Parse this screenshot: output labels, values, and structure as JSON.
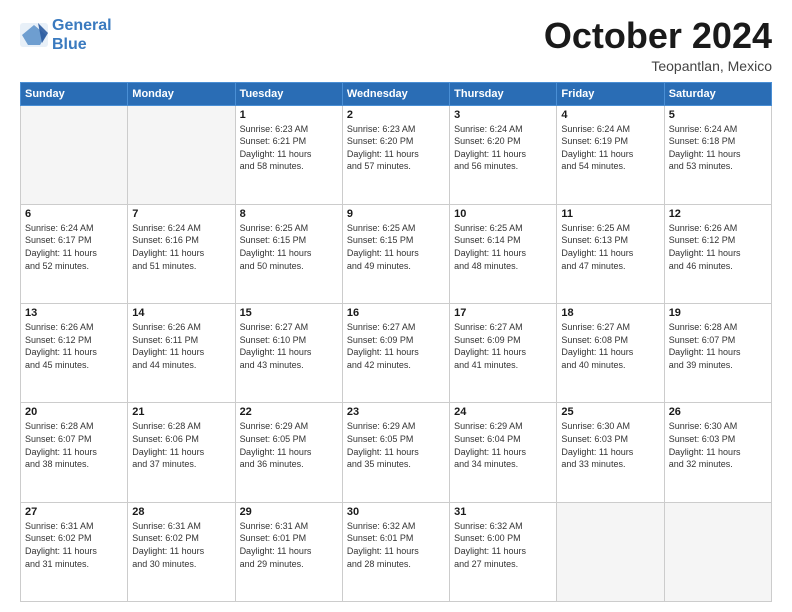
{
  "header": {
    "logo_line1": "General",
    "logo_line2": "Blue",
    "month": "October 2024",
    "location": "Teopantlan, Mexico"
  },
  "weekdays": [
    "Sunday",
    "Monday",
    "Tuesday",
    "Wednesday",
    "Thursday",
    "Friday",
    "Saturday"
  ],
  "weeks": [
    [
      {
        "day": "",
        "info": ""
      },
      {
        "day": "",
        "info": ""
      },
      {
        "day": "1",
        "info": "Sunrise: 6:23 AM\nSunset: 6:21 PM\nDaylight: 11 hours\nand 58 minutes."
      },
      {
        "day": "2",
        "info": "Sunrise: 6:23 AM\nSunset: 6:20 PM\nDaylight: 11 hours\nand 57 minutes."
      },
      {
        "day": "3",
        "info": "Sunrise: 6:24 AM\nSunset: 6:20 PM\nDaylight: 11 hours\nand 56 minutes."
      },
      {
        "day": "4",
        "info": "Sunrise: 6:24 AM\nSunset: 6:19 PM\nDaylight: 11 hours\nand 54 minutes."
      },
      {
        "day": "5",
        "info": "Sunrise: 6:24 AM\nSunset: 6:18 PM\nDaylight: 11 hours\nand 53 minutes."
      }
    ],
    [
      {
        "day": "6",
        "info": "Sunrise: 6:24 AM\nSunset: 6:17 PM\nDaylight: 11 hours\nand 52 minutes."
      },
      {
        "day": "7",
        "info": "Sunrise: 6:24 AM\nSunset: 6:16 PM\nDaylight: 11 hours\nand 51 minutes."
      },
      {
        "day": "8",
        "info": "Sunrise: 6:25 AM\nSunset: 6:15 PM\nDaylight: 11 hours\nand 50 minutes."
      },
      {
        "day": "9",
        "info": "Sunrise: 6:25 AM\nSunset: 6:15 PM\nDaylight: 11 hours\nand 49 minutes."
      },
      {
        "day": "10",
        "info": "Sunrise: 6:25 AM\nSunset: 6:14 PM\nDaylight: 11 hours\nand 48 minutes."
      },
      {
        "day": "11",
        "info": "Sunrise: 6:25 AM\nSunset: 6:13 PM\nDaylight: 11 hours\nand 47 minutes."
      },
      {
        "day": "12",
        "info": "Sunrise: 6:26 AM\nSunset: 6:12 PM\nDaylight: 11 hours\nand 46 minutes."
      }
    ],
    [
      {
        "day": "13",
        "info": "Sunrise: 6:26 AM\nSunset: 6:12 PM\nDaylight: 11 hours\nand 45 minutes."
      },
      {
        "day": "14",
        "info": "Sunrise: 6:26 AM\nSunset: 6:11 PM\nDaylight: 11 hours\nand 44 minutes."
      },
      {
        "day": "15",
        "info": "Sunrise: 6:27 AM\nSunset: 6:10 PM\nDaylight: 11 hours\nand 43 minutes."
      },
      {
        "day": "16",
        "info": "Sunrise: 6:27 AM\nSunset: 6:09 PM\nDaylight: 11 hours\nand 42 minutes."
      },
      {
        "day": "17",
        "info": "Sunrise: 6:27 AM\nSunset: 6:09 PM\nDaylight: 11 hours\nand 41 minutes."
      },
      {
        "day": "18",
        "info": "Sunrise: 6:27 AM\nSunset: 6:08 PM\nDaylight: 11 hours\nand 40 minutes."
      },
      {
        "day": "19",
        "info": "Sunrise: 6:28 AM\nSunset: 6:07 PM\nDaylight: 11 hours\nand 39 minutes."
      }
    ],
    [
      {
        "day": "20",
        "info": "Sunrise: 6:28 AM\nSunset: 6:07 PM\nDaylight: 11 hours\nand 38 minutes."
      },
      {
        "day": "21",
        "info": "Sunrise: 6:28 AM\nSunset: 6:06 PM\nDaylight: 11 hours\nand 37 minutes."
      },
      {
        "day": "22",
        "info": "Sunrise: 6:29 AM\nSunset: 6:05 PM\nDaylight: 11 hours\nand 36 minutes."
      },
      {
        "day": "23",
        "info": "Sunrise: 6:29 AM\nSunset: 6:05 PM\nDaylight: 11 hours\nand 35 minutes."
      },
      {
        "day": "24",
        "info": "Sunrise: 6:29 AM\nSunset: 6:04 PM\nDaylight: 11 hours\nand 34 minutes."
      },
      {
        "day": "25",
        "info": "Sunrise: 6:30 AM\nSunset: 6:03 PM\nDaylight: 11 hours\nand 33 minutes."
      },
      {
        "day": "26",
        "info": "Sunrise: 6:30 AM\nSunset: 6:03 PM\nDaylight: 11 hours\nand 32 minutes."
      }
    ],
    [
      {
        "day": "27",
        "info": "Sunrise: 6:31 AM\nSunset: 6:02 PM\nDaylight: 11 hours\nand 31 minutes."
      },
      {
        "day": "28",
        "info": "Sunrise: 6:31 AM\nSunset: 6:02 PM\nDaylight: 11 hours\nand 30 minutes."
      },
      {
        "day": "29",
        "info": "Sunrise: 6:31 AM\nSunset: 6:01 PM\nDaylight: 11 hours\nand 29 minutes."
      },
      {
        "day": "30",
        "info": "Sunrise: 6:32 AM\nSunset: 6:01 PM\nDaylight: 11 hours\nand 28 minutes."
      },
      {
        "day": "31",
        "info": "Sunrise: 6:32 AM\nSunset: 6:00 PM\nDaylight: 11 hours\nand 27 minutes."
      },
      {
        "day": "",
        "info": ""
      },
      {
        "day": "",
        "info": ""
      }
    ]
  ]
}
